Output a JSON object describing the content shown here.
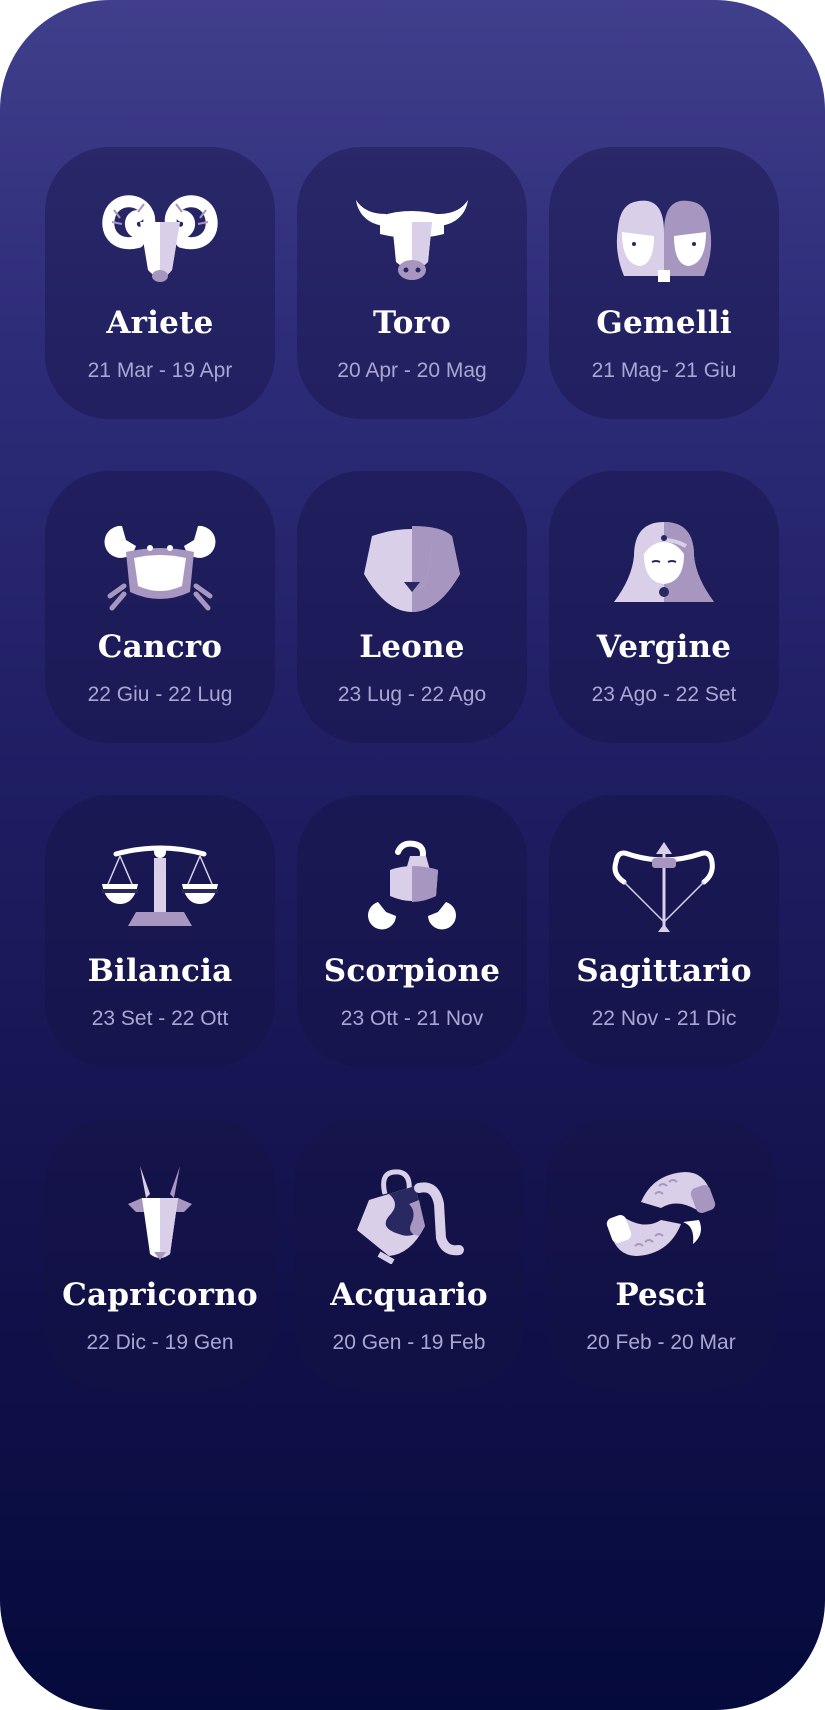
{
  "signs": [
    {
      "name": "Ariete",
      "dates": "21 Mar - 19 Apr",
      "icon": "aries-icon"
    },
    {
      "name": "Toro",
      "dates": "20 Apr - 20 Mag",
      "icon": "taurus-icon"
    },
    {
      "name": "Gemelli",
      "dates": "21 Mag- 21 Giu",
      "icon": "gemini-icon"
    },
    {
      "name": "Cancro",
      "dates": "22 Giu - 22 Lug",
      "icon": "cancer-icon"
    },
    {
      "name": "Leone",
      "dates": "23 Lug - 22 Ago",
      "icon": "leo-icon"
    },
    {
      "name": "Vergine",
      "dates": "23 Ago - 22 Set",
      "icon": "virgo-icon"
    },
    {
      "name": "Bilancia",
      "dates": "23 Set - 22 Ott",
      "icon": "libra-icon"
    },
    {
      "name": "Scorpione",
      "dates": "23 Ott - 21 Nov",
      "icon": "scorpio-icon"
    },
    {
      "name": "Sagittario",
      "dates": "22 Nov - 21 Dic",
      "icon": "sagittarius-icon"
    },
    {
      "name": "Capricorno",
      "dates": "22 Dic - 19 Gen",
      "icon": "capricorn-icon"
    },
    {
      "name": "Acquario",
      "dates": "20 Gen - 19 Feb",
      "icon": "aquarius-icon"
    },
    {
      "name": "Pesci",
      "dates": "20 Feb - 20 Mar",
      "icon": "pisces-icon"
    }
  ],
  "colors": {
    "background_top": "#403f8c",
    "background_bottom": "#050a3c",
    "card": "#1e1c58",
    "icon_white": "#ffffff",
    "icon_lilac": "#d9cfe8",
    "icon_purple": "#a796bf",
    "date_text": "#a9a7d2"
  }
}
